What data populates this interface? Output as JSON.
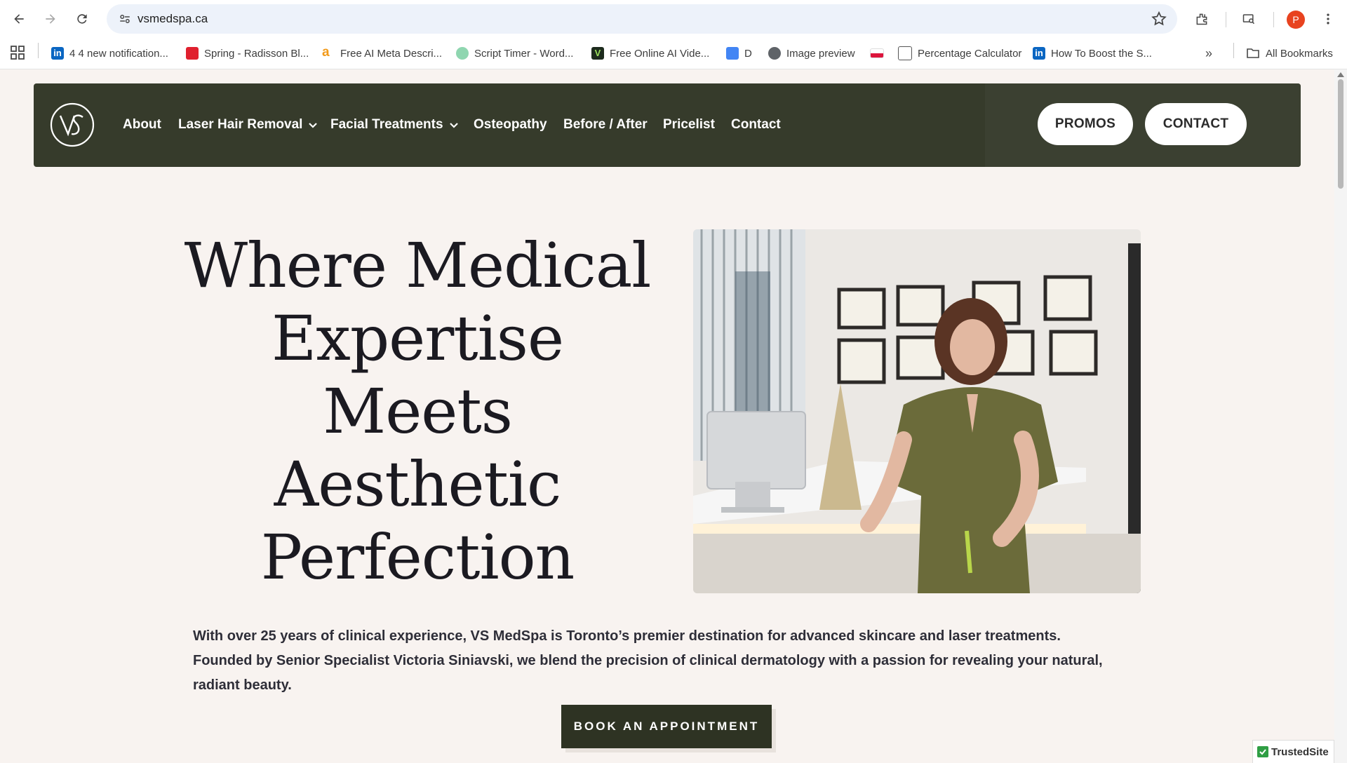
{
  "browser": {
    "url": "vsmedspa.ca",
    "profile_initial": "P",
    "bookmarks": [
      {
        "label": "4 4 new notification...",
        "icon": "linkedin-icon"
      },
      {
        "label": "Spring - Radisson Bl...",
        "icon": "radisson-icon"
      },
      {
        "label": "Free AI Meta Descri...",
        "icon": "a-icon"
      },
      {
        "label": "Script Timer - Word...",
        "icon": "timer-icon"
      },
      {
        "label": "Free Online AI Vide...",
        "icon": "v-icon"
      },
      {
        "label": "D",
        "icon": "docs-icon"
      },
      {
        "label": "Image preview",
        "icon": "globe-icon"
      },
      {
        "label": "",
        "icon": "flag-icon"
      },
      {
        "label": "Percentage Calculator",
        "icon": "calculator-icon"
      },
      {
        "label": "How To Boost the S...",
        "icon": "linkedin-icon"
      }
    ],
    "all_bookmarks_label": "All Bookmarks"
  },
  "nav": {
    "items": [
      {
        "label": "About",
        "dropdown": false
      },
      {
        "label": "Laser Hair Removal",
        "dropdown": true
      },
      {
        "label": "Facial Treatments",
        "dropdown": true
      },
      {
        "label": "Osteopathy",
        "dropdown": false
      },
      {
        "label": "Before / After",
        "dropdown": false
      },
      {
        "label": "Pricelist",
        "dropdown": false
      },
      {
        "label": "Contact",
        "dropdown": false
      }
    ],
    "promos_label": "PROMOS",
    "contact_label": "CONTACT"
  },
  "hero": {
    "headline_lines": [
      "Where Medical",
      "Expertise",
      "Meets",
      "Aesthetic",
      "Perfection"
    ],
    "intro_lines": [
      "With over 25 years of clinical experience, VS MedSpa is Toronto’s premier destination for advanced skincare and laser treatments.",
      "Founded by Senior Specialist Victoria Siniavski, we blend the precision of clinical dermatology with a passion for revealing your natural,",
      "radiant beauty."
    ],
    "cta_label": "BOOK AN APPOINTMENT"
  },
  "badge": {
    "label": "TrustedSite"
  },
  "colors": {
    "nav_bg": "#363b2b",
    "page_bg": "#f8f3f0",
    "cta_bg": "#2e3323",
    "headline": "#1b1a21"
  }
}
